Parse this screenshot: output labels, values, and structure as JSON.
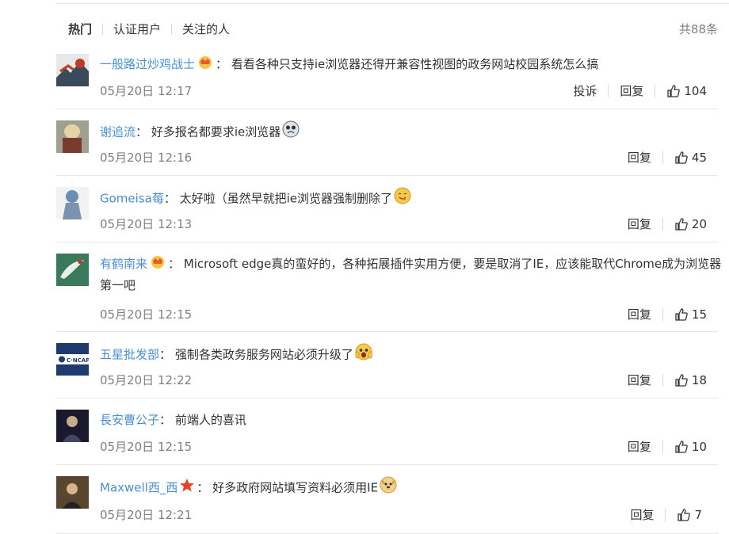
{
  "tabs": [
    {
      "label": "热门",
      "active": true
    },
    {
      "label": "认证用户",
      "active": false
    },
    {
      "label": "关注的人",
      "active": false
    }
  ],
  "total": "共88条",
  "actions": {
    "report": "投诉",
    "reply": "回复"
  },
  "comments": [
    {
      "user": "一般路过炒鸡战士",
      "badge": "crown-icon",
      "text": "看看各种只支持ie浏览器还得开兼容性视图的政务网站校园系统怎么搞",
      "time": "05月20日 12:17",
      "likes": "104",
      "has_report": true
    },
    {
      "user": "谢追流",
      "badge": "",
      "text": "好多报名都要求ie浏览器",
      "emoji": "crying-face-emoji",
      "time": "05月20日 12:16",
      "likes": "45"
    },
    {
      "user": "Gomeisa莓",
      "badge": "",
      "text": "太好啦（虽然早就把ie浏览器强制删除了",
      "emoji": "yummy-face-emoji",
      "time": "05月20日 12:13",
      "likes": "20"
    },
    {
      "user": "有鹤南来",
      "badge": "crown-icon",
      "text": "Microsoft edge真的蛮好的，各种拓展插件实用方便，要是取消了IE，应该能取代Chrome成为浏览器第一吧",
      "time": "05月20日 12:15",
      "likes": "15"
    },
    {
      "user": "五星批发部",
      "badge": "",
      "text": "强制各类政务服务网站必须升级了",
      "emoji": "scream-face-emoji",
      "time": "05月20日 12:22",
      "likes": "18"
    },
    {
      "user": "長安曹公子",
      "badge": "",
      "text": "前端人的喜讯",
      "time": "05月20日 12:15",
      "likes": "10"
    },
    {
      "user": "Maxwell西_西",
      "badge": "star-icon",
      "text": "好多政府网站填写资料必须用IE",
      "emoji": "doge-emoji",
      "time": "05月20日 12:21",
      "likes": "7"
    }
  ]
}
